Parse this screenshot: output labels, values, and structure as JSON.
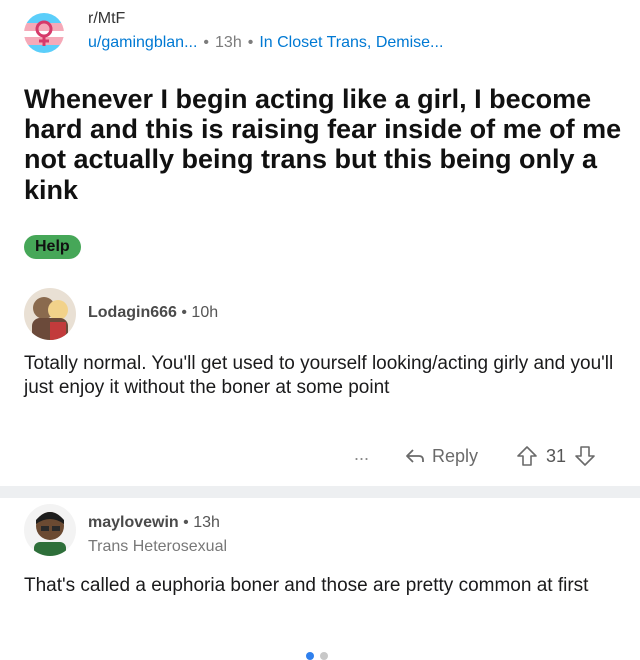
{
  "post": {
    "subreddit": "r/MtF",
    "author": "u/gamingblan...",
    "time": "13h",
    "author_flair": "In Closet Trans, Demise...",
    "title": "Whenever I begin acting like a girl, I become hard and this is raising fear inside of me of me not actually being trans but this being only a kink",
    "flair": "Help"
  },
  "comments": [
    {
      "author": "Lodagin666",
      "time": "10h",
      "body": "Totally normal. You'll get used to yourself looking/acting girly and you'll just enjoy it without the boner at some point",
      "more": "...",
      "reply_label": "Reply",
      "votes": "31"
    },
    {
      "author": "maylovewin",
      "time": "13h",
      "flair": "Trans Heterosexual",
      "body": "That's called a euphoria boner and those are pretty common at first"
    }
  ],
  "separator_dot": "•",
  "colors": {
    "accent_blue": "#0079d3",
    "flair_green": "#46a758",
    "pager_active": "#2f80ed",
    "pager_inactive": "#c8c8c8"
  },
  "pager": {
    "count": 2,
    "active_index": 0
  }
}
